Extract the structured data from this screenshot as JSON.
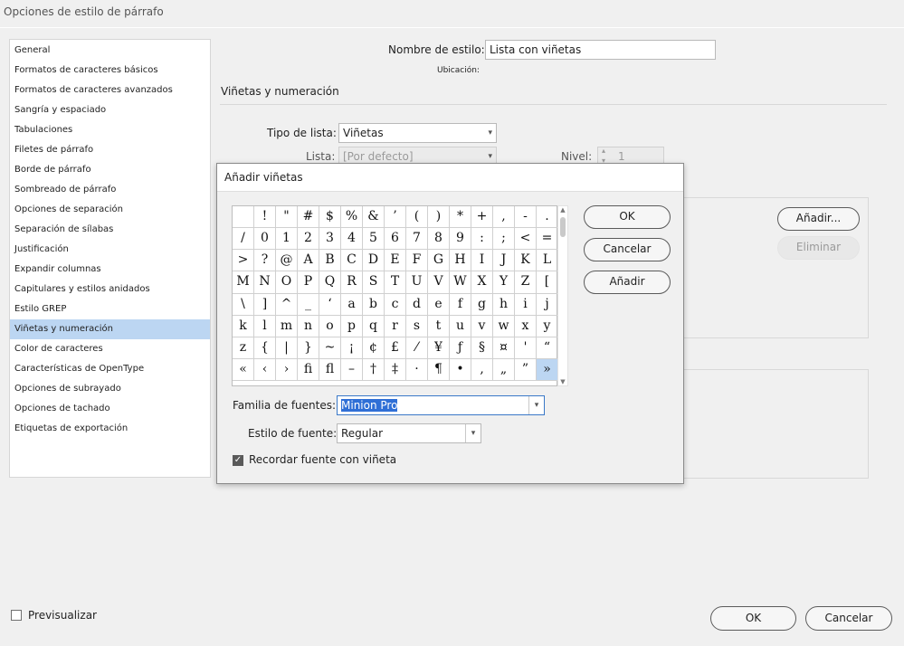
{
  "window": {
    "title": "Opciones de estilo de párrafo"
  },
  "sidebar": {
    "items": [
      {
        "label": "General"
      },
      {
        "label": "Formatos de caracteres básicos"
      },
      {
        "label": "Formatos de caracteres avanzados"
      },
      {
        "label": "Sangría y espaciado"
      },
      {
        "label": "Tabulaciones"
      },
      {
        "label": "Filetes de párrafo"
      },
      {
        "label": "Borde de párrafo"
      },
      {
        "label": "Sombreado de párrafo"
      },
      {
        "label": "Opciones de separación"
      },
      {
        "label": "Separación de sílabas"
      },
      {
        "label": "Justificación"
      },
      {
        "label": "Expandir columnas"
      },
      {
        "label": "Capitulares y estilos anidados"
      },
      {
        "label": "Estilo GREP"
      },
      {
        "label": "Viñetas y numeración",
        "selected": true
      },
      {
        "label": "Color de caracteres"
      },
      {
        "label": "Características de OpenType"
      },
      {
        "label": "Opciones de subrayado"
      },
      {
        "label": "Opciones de tachado"
      },
      {
        "label": "Etiquetas de exportación"
      }
    ]
  },
  "main": {
    "style_name_label": "Nombre de estilo:",
    "style_name_value": "Lista con viñetas",
    "location_label": "Ubicación:",
    "section_title": "Viñetas y numeración",
    "list_type_label": "Tipo de lista:",
    "list_type_value": "Viñetas",
    "list_label": "Lista:",
    "list_value": "[Por defecto]",
    "level_label": "Nivel:",
    "level_value": "1",
    "add_button": "Añadir...",
    "delete_button": "Eliminar"
  },
  "dialog": {
    "title": "Añadir viñetas",
    "glyphs": [
      " ",
      "!",
      "\"",
      "#",
      "$",
      "%",
      "&",
      "’",
      "(",
      ")",
      "*",
      "+",
      ",",
      "-",
      ".",
      "/",
      "0",
      "1",
      "2",
      "3",
      "4",
      "5",
      "6",
      "7",
      "8",
      "9",
      ":",
      ";",
      "<",
      "=",
      ">",
      "?",
      "@",
      "A",
      "B",
      "C",
      "D",
      "E",
      "F",
      "G",
      "H",
      "I",
      "J",
      "K",
      "L",
      "M",
      "N",
      "O",
      "P",
      "Q",
      "R",
      "S",
      "T",
      "U",
      "V",
      "W",
      "X",
      "Y",
      "Z",
      "[",
      "\\",
      "]",
      "^",
      "_",
      "‘",
      "a",
      "b",
      "c",
      "d",
      "e",
      "f",
      "g",
      "h",
      "i",
      "j",
      "k",
      "l",
      "m",
      "n",
      "o",
      "p",
      "q",
      "r",
      "s",
      "t",
      "u",
      "v",
      "w",
      "x",
      "y",
      "z",
      "{",
      "|",
      "}",
      "~",
      "¡",
      "¢",
      "£",
      "⁄",
      "¥",
      "ƒ",
      "§",
      "¤",
      "'",
      "“",
      "«",
      "‹",
      "›",
      "ﬁ",
      "ﬂ",
      "–",
      "†",
      "‡",
      "·",
      "¶",
      "•",
      "‚",
      "„",
      "”",
      "»"
    ],
    "selected_glyph": "»",
    "ok_button": "OK",
    "cancel_button": "Cancelar",
    "add_button": "Añadir",
    "font_family_label": "Familia de fuentes:",
    "font_family_value": "Minion Pro",
    "font_style_label": "Estilo de fuente:",
    "font_style_value": "Regular",
    "remember_font_label": "Recordar fuente con viñeta",
    "remember_font_checked": true
  },
  "footer": {
    "preview_label": "Previsualizar",
    "preview_checked": false,
    "ok_button": "OK",
    "cancel_button": "Cancelar"
  },
  "colors": {
    "selection": "#bcd6f2",
    "text_highlight": "#2f6fd6"
  }
}
